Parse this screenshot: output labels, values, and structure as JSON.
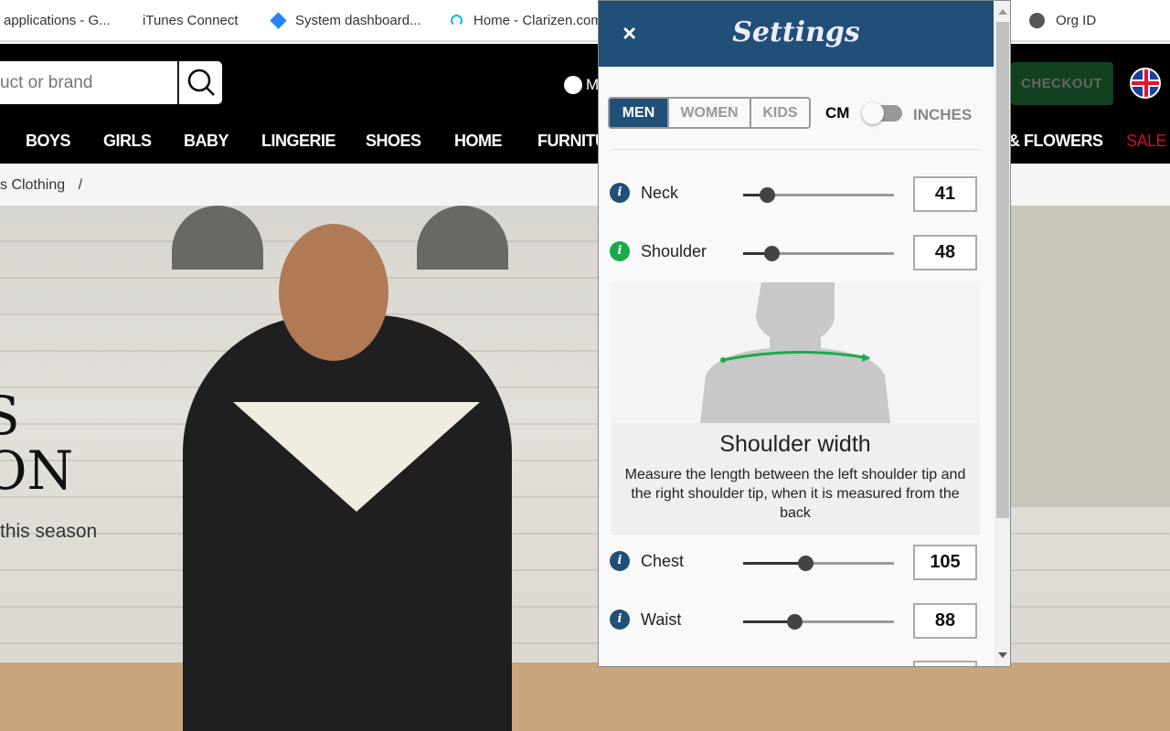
{
  "bookmarks": [
    {
      "label": "applications - G...",
      "icon": "page-icon"
    },
    {
      "label": "iTunes Connect",
      "icon": "apple-icon"
    },
    {
      "label": "System dashboard...",
      "icon": "jira-icon"
    },
    {
      "label": "Home - Clarizen.com",
      "icon": "clarizen-icon"
    },
    {
      "label": "Org ID",
      "icon": "globe-icon"
    }
  ],
  "header": {
    "search_placeholder": "uct or brand",
    "account_label": "M",
    "checkout_label": "CHECKOUT",
    "flag": "uk-flag"
  },
  "nav": [
    "BOYS",
    "GIRLS",
    "BABY",
    "LINGERIE",
    "SHOES",
    "HOME",
    "FURNITURE",
    "& FLOWERS",
    "SALE"
  ],
  "breadcrumb": {
    "item": "s Clothing",
    "sep": "/"
  },
  "hero": {
    "headline1": "S",
    "headline2": "ON",
    "tagline": "this season"
  },
  "settings": {
    "title": "Settings",
    "close": "×",
    "genders": [
      "MEN",
      "WOMEN",
      "KIDS"
    ],
    "selected_gender": "MEN",
    "unit_left": "CM",
    "unit_right": "INCHES",
    "unit_selected": "CM",
    "measurements": [
      {
        "label": "Neck",
        "value": "41",
        "slider": 0.16,
        "info_color": "#204f78"
      },
      {
        "label": "Shoulder",
        "value": "48",
        "slider": 0.19,
        "info_color": "#1aaa4a"
      },
      {
        "label": "Chest",
        "value": "105",
        "slider": 0.41,
        "info_color": "#204f78"
      },
      {
        "label": "Waist",
        "value": "88",
        "slider": 0.34,
        "info_color": "#204f78"
      }
    ],
    "help": {
      "title": "Shoulder width",
      "text": "Measure the length between the left shoulder tip and the right shoulder tip, when it is measured from the back"
    }
  },
  "colors": {
    "brand_blue": "#204f78",
    "green": "#1aaa4a",
    "sale_red": "#c8102e",
    "checkout_bg": "#12411f"
  }
}
